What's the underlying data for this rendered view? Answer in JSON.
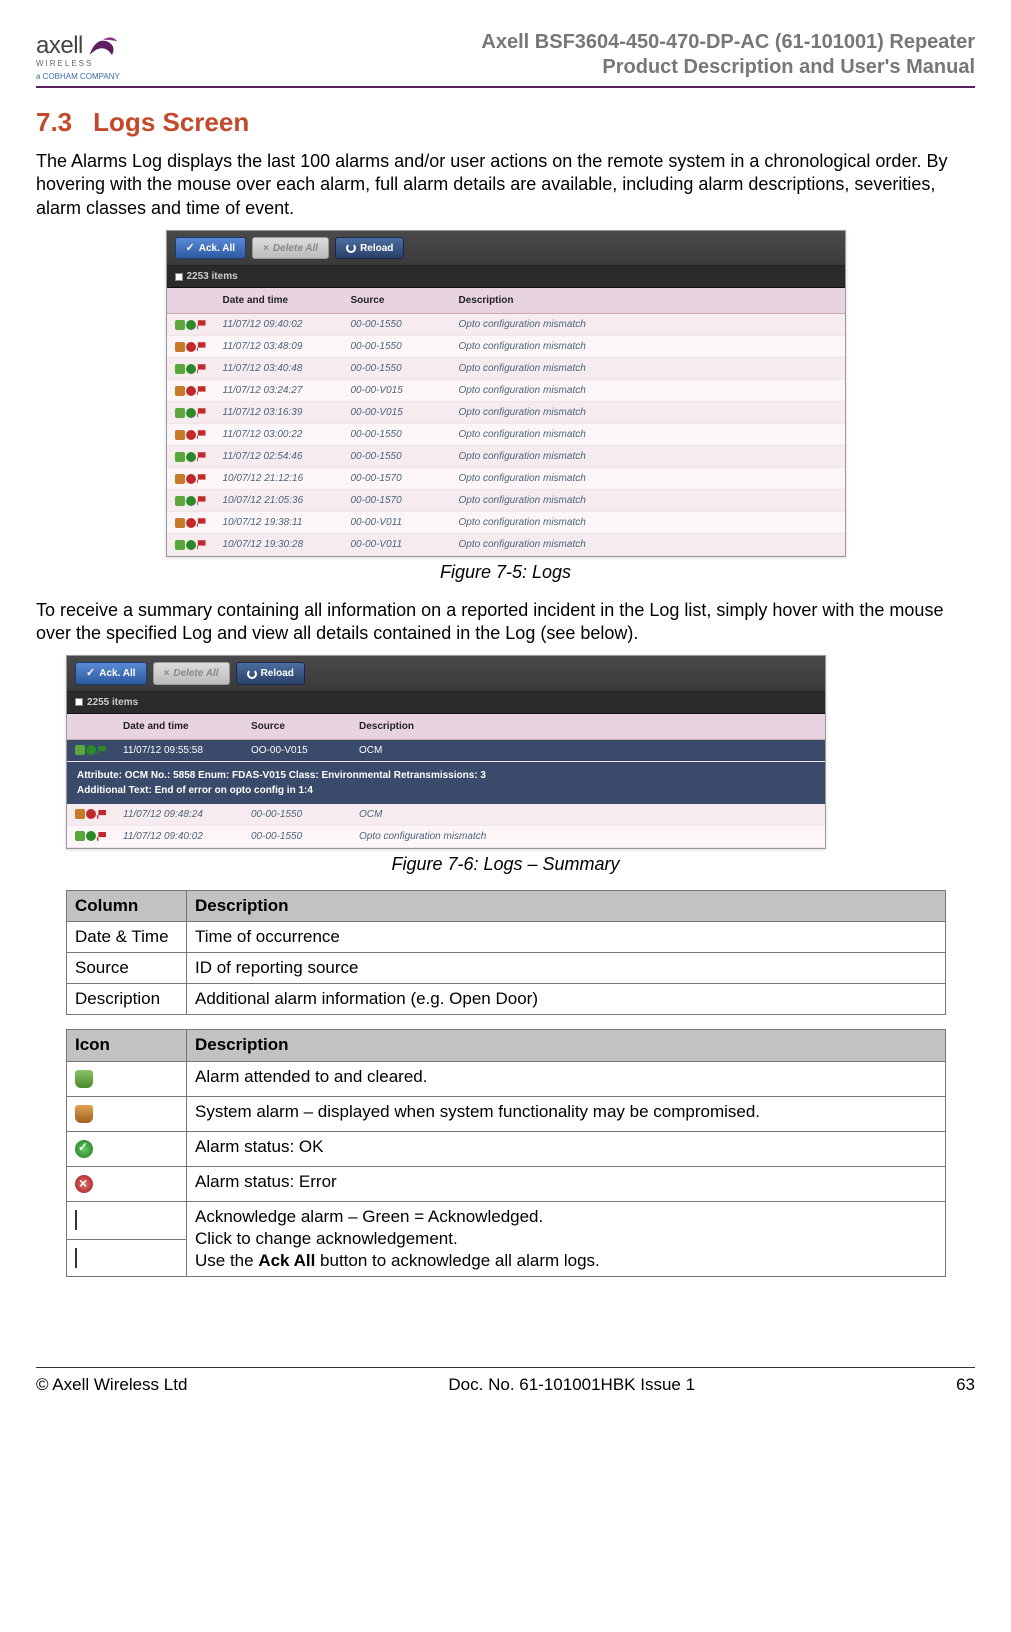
{
  "header": {
    "logo_main": "axell",
    "logo_sub": "WIRELESS",
    "logo_cob": "a COBHAM COMPANY",
    "title_line1": "Axell BSF3604-450-470-DP-AC (61-101001) Repeater",
    "title_line2": "Product Description and User's Manual"
  },
  "section": {
    "num": "7.3",
    "title": "Logs Screen"
  },
  "para1": "The Alarms Log displays the last 100 alarms and/or user actions on the remote system in a chronological order. By hovering with the mouse over each alarm, full alarm details are available, including alarm descriptions, severities, alarm classes and time of event.",
  "caption1": "Figure 7-5:  Logs",
  "para2": "To receive a summary containing all information on a reported incident in the Log list, simply hover with the mouse over the specified Log and view all details contained in the Log (see below).",
  "caption2": "Figure 7-6: Logs – Summary",
  "shot1": {
    "toolbar": {
      "ack_all": "Ack. All",
      "delete_all": "Delete All",
      "reload": "Reload"
    },
    "items_count": "2253 items",
    "cols": {
      "c1": "",
      "c2": "Date and time",
      "c3": "Source",
      "c4": "Description"
    },
    "rows": [
      {
        "t": "g",
        "dt": "11/07/12 09:40:02",
        "src": "00-00-1550",
        "desc": "Opto configuration mismatch"
      },
      {
        "t": "r",
        "dt": "11/07/12 03:48:09",
        "src": "00-00-1550",
        "desc": "Opto configuration mismatch"
      },
      {
        "t": "g",
        "dt": "11/07/12 03:40:48",
        "src": "00-00-1550",
        "desc": "Opto configuration mismatch"
      },
      {
        "t": "r",
        "dt": "11/07/12 03:24:27",
        "src": "00-00-V015",
        "desc": "Opto configuration mismatch"
      },
      {
        "t": "g",
        "dt": "11/07/12 03:16:39",
        "src": "00-00-V015",
        "desc": "Opto configuration mismatch"
      },
      {
        "t": "r",
        "dt": "11/07/12 03:00:22",
        "src": "00-00-1550",
        "desc": "Opto configuration mismatch"
      },
      {
        "t": "g",
        "dt": "11/07/12 02:54:46",
        "src": "00-00-1550",
        "desc": "Opto configuration mismatch"
      },
      {
        "t": "r",
        "dt": "10/07/12 21:12:16",
        "src": "00-00-1570",
        "desc": "Opto configuration mismatch"
      },
      {
        "t": "g",
        "dt": "10/07/12 21:05:36",
        "src": "00-00-1570",
        "desc": "Opto configuration mismatch"
      },
      {
        "t": "r",
        "dt": "10/07/12 19:38:11",
        "src": "00-00-V011",
        "desc": "Opto configuration mismatch"
      },
      {
        "t": "g",
        "dt": "10/07/12 19:30:28",
        "src": "00-00-V011",
        "desc": "Opto configuration mismatch"
      }
    ]
  },
  "shot2": {
    "toolbar": {
      "ack_all": "Ack. All",
      "delete_all": "Delete All",
      "reload": "Reload"
    },
    "items_count": "2255 items",
    "cols": {
      "c1": "",
      "c2": "Date and time",
      "c3": "Source",
      "c4": "Description"
    },
    "selected": {
      "dt": "11/07/12 09:55:58",
      "src": "OO-00-V015",
      "desc": "OCM"
    },
    "detail_line1": "Attribute: OCM    No.: 5858    Enum: FDAS-V015    Class: Environmental    Retransmissions: 3",
    "detail_line2": "Additional Text: End of error on opto config in 1:4",
    "rows": [
      {
        "t": "r",
        "dt": "11/07/12 09:48:24",
        "src": "00-00-1550",
        "desc": "OCM"
      },
      {
        "t": "g",
        "dt": "11/07/12 09:40:02",
        "src": "00-00-1550",
        "desc": "Opto configuration mismatch"
      }
    ]
  },
  "table1": {
    "h1": "Column",
    "h2": "Description",
    "rows": [
      {
        "c": "Date & Time",
        "d": "Time of occurrence"
      },
      {
        "c": "Source",
        "d": "ID of reporting source"
      },
      {
        "c": "Description",
        "d": "Additional alarm information (e.g. Open Door)"
      }
    ]
  },
  "table2": {
    "h1": "Icon",
    "h2": "Description",
    "rows": [
      {
        "icon": "bell-g",
        "d": "Alarm attended to and cleared."
      },
      {
        "icon": "bell-o",
        "d": "System alarm – displayed when system functionality may be compromised."
      },
      {
        "icon": "ok",
        "d": "Alarm status: OK"
      },
      {
        "icon": "err",
        "d": "Alarm status: Error"
      }
    ],
    "flagrow_line1": "Acknowledge alarm – Green = Acknowledged.",
    "flagrow_line2": "Click to change acknowledgement.",
    "flagrow_line3_pre": "Use the ",
    "flagrow_line3_bold": "Ack All",
    "flagrow_line3_post": " button to acknowledge all alarm logs."
  },
  "footer": {
    "left": "© Axell Wireless Ltd",
    "center": "Doc. No. 61-101001HBK Issue 1",
    "right": "63"
  }
}
